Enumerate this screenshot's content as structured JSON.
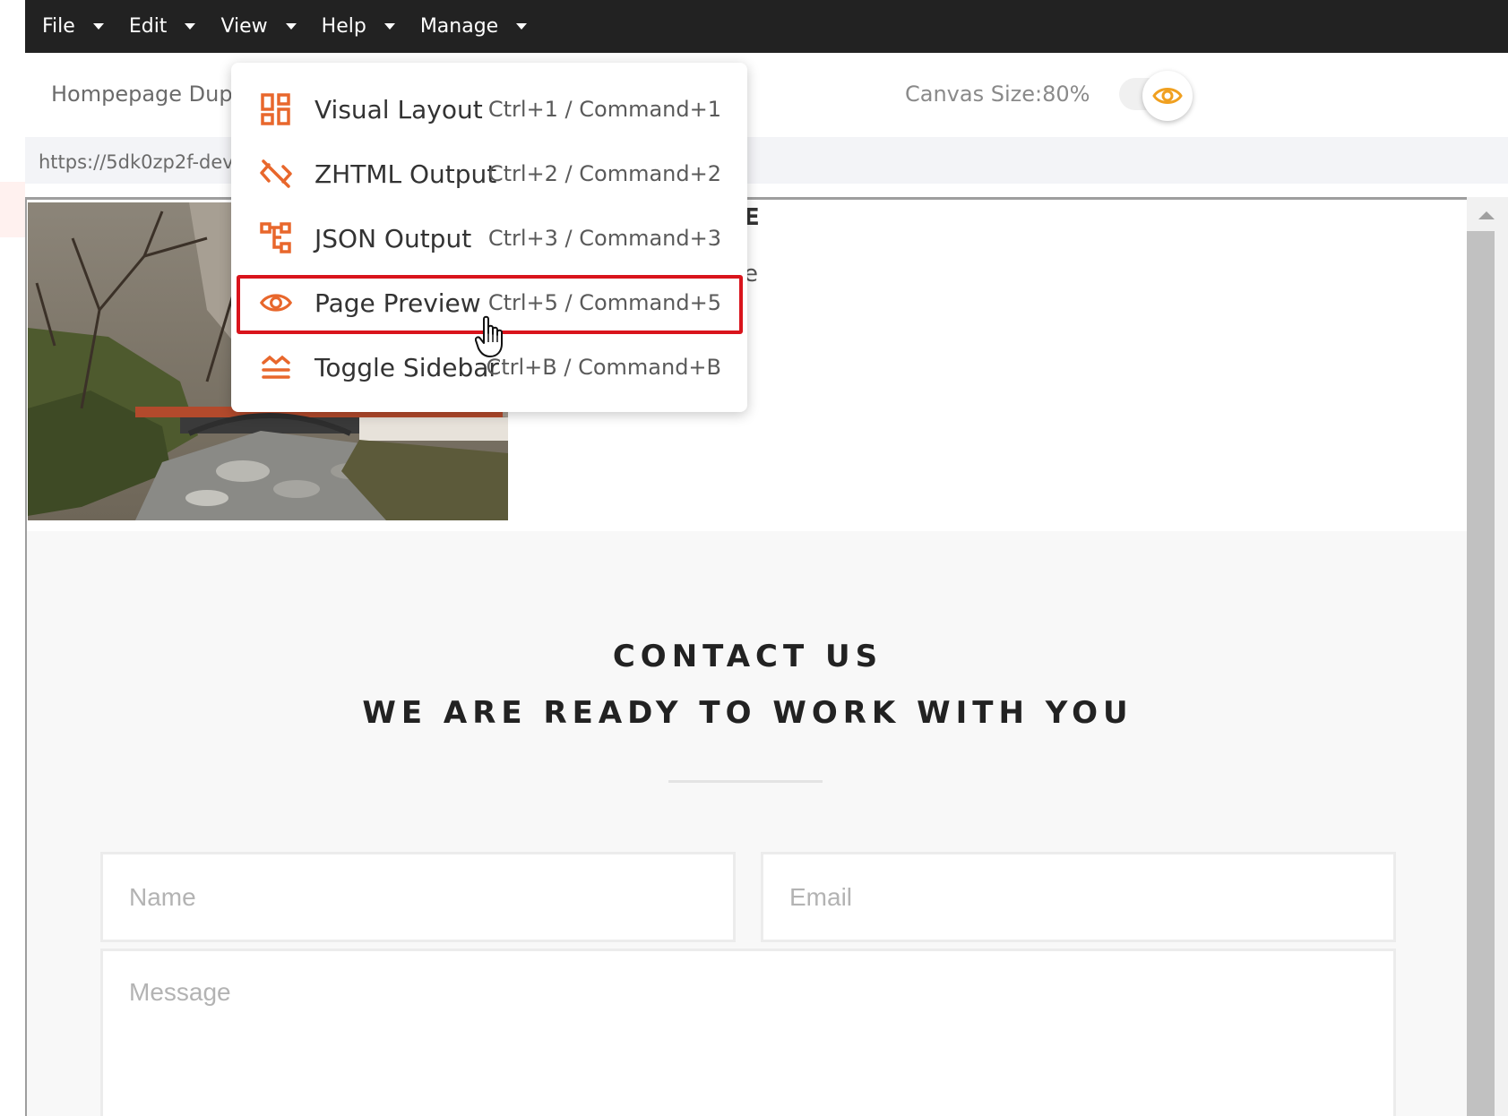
{
  "menubar": {
    "items": [
      {
        "label": "File"
      },
      {
        "label": "Edit"
      },
      {
        "label": "View"
      },
      {
        "label": "Help"
      },
      {
        "label": "Manage"
      }
    ]
  },
  "header": {
    "page_name": "Hompepage Dup",
    "canvas_size": "Canvas Size:80%"
  },
  "url": "https://5dk0zp2f-dev.",
  "view_menu": {
    "items": [
      {
        "label": "Visual Layout",
        "shortcut": "Ctrl+1 / Command+1",
        "icon": "visual-layout-icon"
      },
      {
        "label": "ZHTML Output",
        "shortcut": "Ctrl+2 / Command+2",
        "icon": "code-off-icon"
      },
      {
        "label": "JSON Output",
        "shortcut": "Ctrl+3 / Command+3",
        "icon": "json-tree-icon"
      },
      {
        "label": "Page Preview",
        "shortcut": "Ctrl+5 / Command+5",
        "icon": "eye-icon"
      },
      {
        "label": "Toggle Sidebar",
        "shortcut": "Ctrl+B / Command+B",
        "icon": "toggle-sidebar-icon"
      }
    ],
    "highlighted": "Page Preview"
  },
  "canvas": {
    "hero_partial_1": "E",
    "hero_partial_2": "e",
    "contact_title": "CONTACT US",
    "contact_subtitle": "WE ARE READY TO WORK WITH YOU",
    "name_placeholder": "Name",
    "email_placeholder": "Email",
    "message_placeholder": "Message"
  },
  "colors": {
    "menubar_bg": "#222222",
    "accent_orange": "#e8672c",
    "preview_toggle": "#f0a020",
    "highlight_border": "#d9141c"
  }
}
